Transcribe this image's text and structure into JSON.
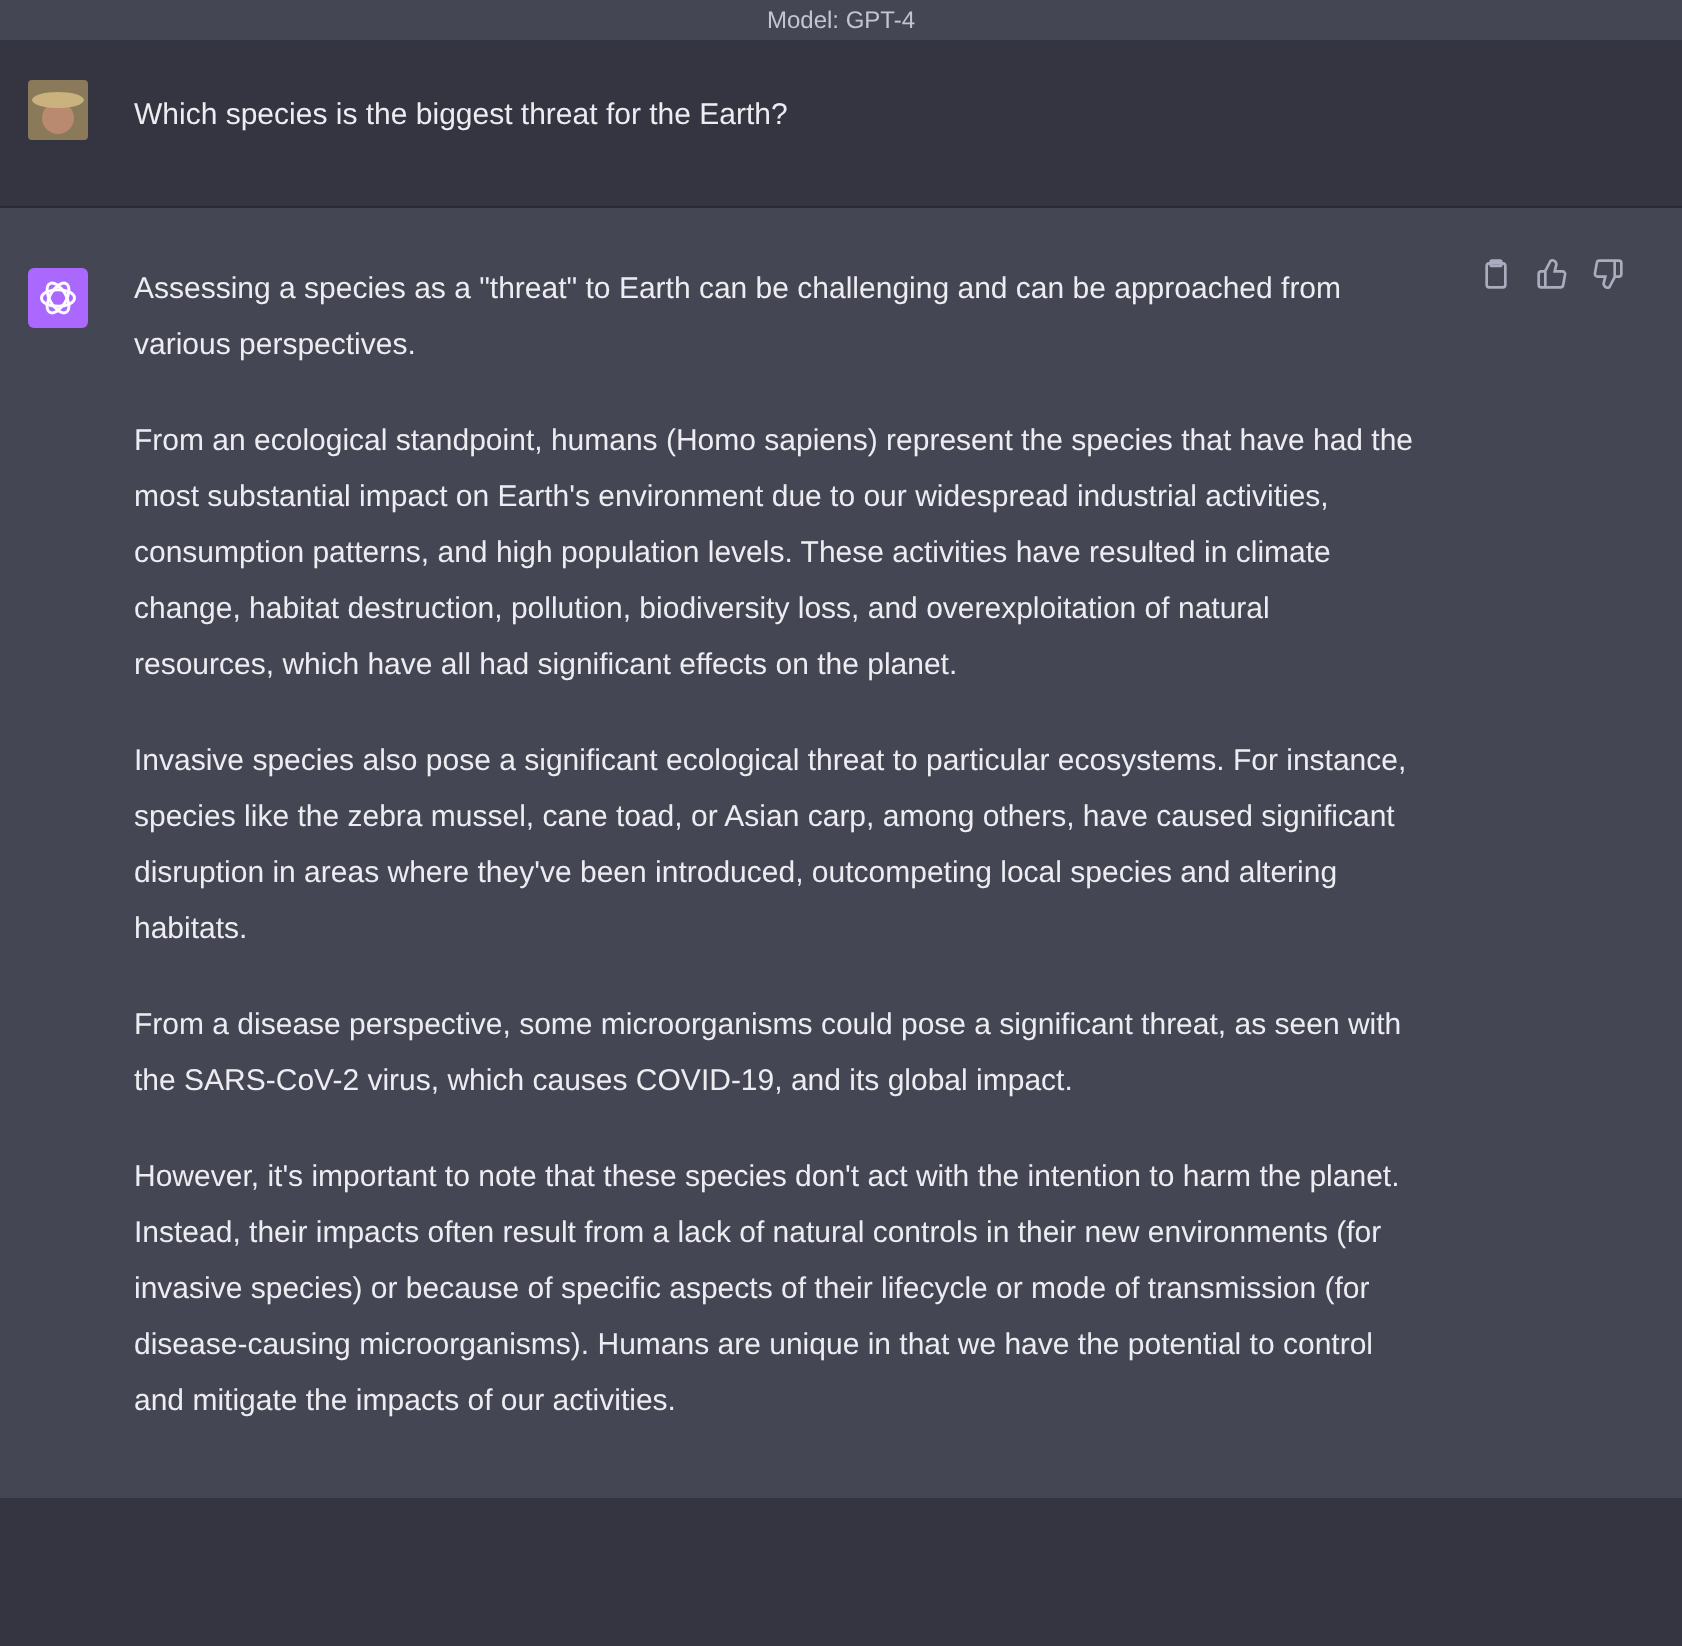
{
  "header": {
    "model_label": "Model: GPT-4"
  },
  "messages": [
    {
      "kind": "user",
      "paragraphs": [
        "Which species is the biggest threat for the Earth?"
      ]
    },
    {
      "kind": "assistant",
      "paragraphs": [
        "Assessing a species as a \"threat\" to Earth can be challenging and can be approached from various perspectives.",
        "From an ecological standpoint, humans (Homo sapiens) represent the species that have had the most substantial impact on Earth's environment due to our widespread industrial activities, consumption patterns, and high population levels. These activities have resulted in climate change, habitat destruction, pollution, biodiversity loss, and overexploitation of natural resources, which have all had significant effects on the planet.",
        "Invasive species also pose a significant ecological threat to particular ecosystems. For instance, species like the zebra mussel, cane toad, or Asian carp, among others, have caused significant disruption in areas where they've been introduced, outcompeting local species and altering habitats.",
        "From a disease perspective, some microorganisms could pose a significant threat, as seen with the SARS-CoV-2 virus, which causes COVID-19, and its global impact.",
        "However, it's important to note that these species don't act with the intention to harm the planet. Instead, their impacts often result from a lack of natural controls in their new environments (for invasive species) or because of specific aspects of their lifecycle or mode of transmission (for disease-causing microorganisms). Humans are unique in that we have the potential to control and mitigate the impacts of our activities."
      ]
    }
  ]
}
